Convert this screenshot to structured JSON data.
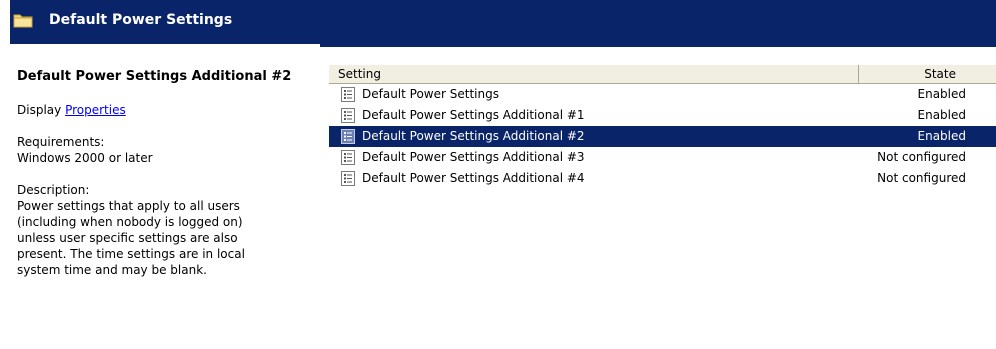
{
  "header": {
    "title": "Default Power Settings"
  },
  "detail": {
    "title": "Default Power Settings Additional #2",
    "display_prefix": "Display",
    "display_link": "Properties ",
    "requirements_label": "Requirements:",
    "requirements_value": "Windows 2000 or later",
    "description_label": "Description:",
    "description_lines": [
      "Power settings that apply to all users",
      "(including when nobody is logged on)",
      "unless user specific settings are also",
      "present. The time settings are in local",
      "system time and may be blank."
    ]
  },
  "list": {
    "columns": {
      "setting": "Setting",
      "state": "State"
    },
    "rows": [
      {
        "setting": "Default Power Settings",
        "state": "Enabled"
      },
      {
        "setting": "Default Power Settings Additional #1",
        "state": "Enabled"
      },
      {
        "setting": "Default Power Settings Additional #2",
        "state": "Enabled"
      },
      {
        "setting": "Default Power Settings Additional #3",
        "state": "Not configured"
      },
      {
        "setting": "Default Power Settings Additional #4",
        "state": "Not configured"
      }
    ],
    "selected_index": 2
  },
  "colors": {
    "accent": "#0a246a",
    "header_bg": "#f1efe2",
    "link": "#0000ee"
  },
  "icons": {
    "header": "folder-icon",
    "row": "policy-setting-icon"
  }
}
